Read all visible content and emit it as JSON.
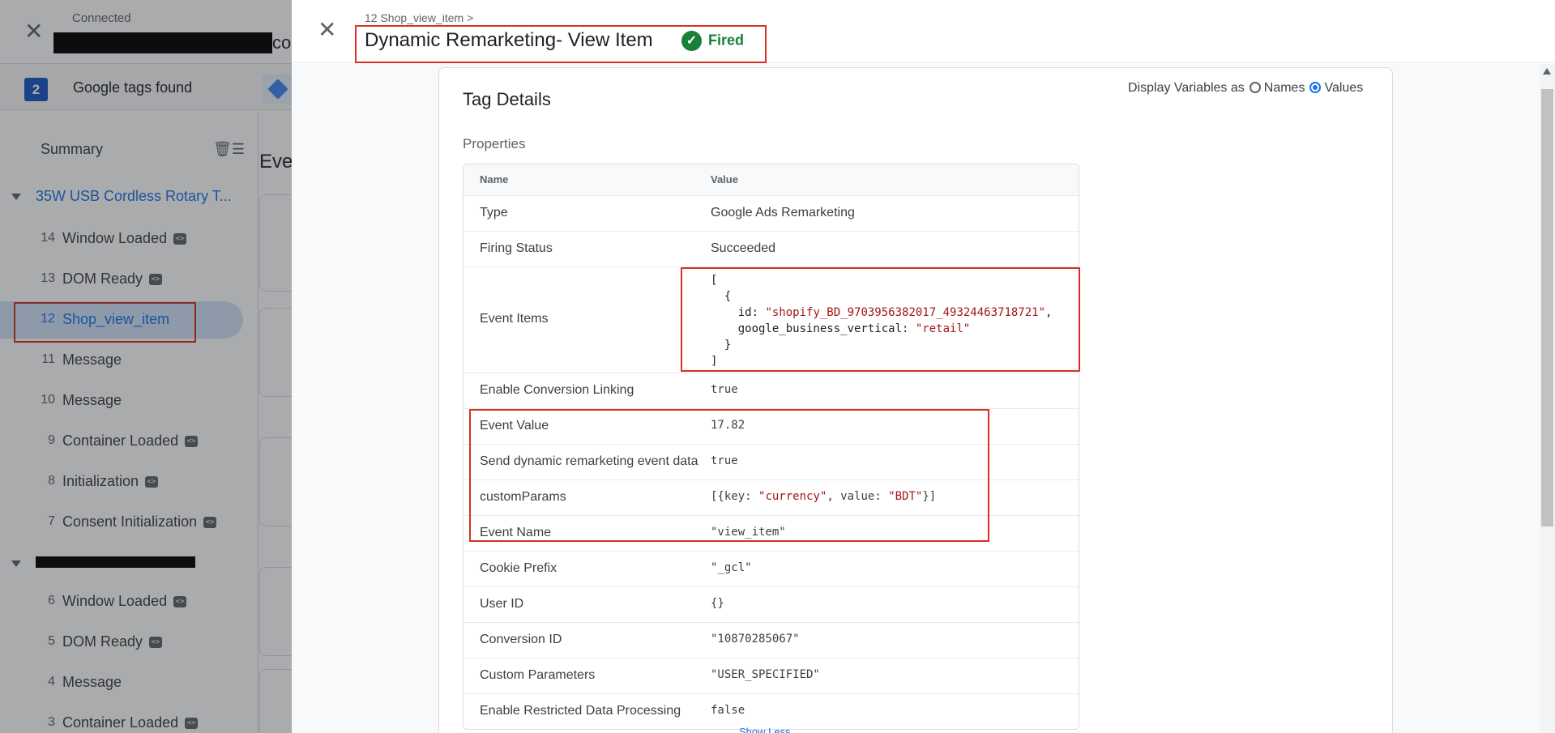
{
  "bg": {
    "connected": "Connected",
    "url_tail": "con",
    "tag_count": "2",
    "tags_found": "Google tags found",
    "main_heading": "Eve",
    "sidebar": {
      "summary": "Summary",
      "group1": "35W USB Cordless Rotary T...",
      "items": [
        {
          "num": "14",
          "label": "Window Loaded",
          "code": true
        },
        {
          "num": "13",
          "label": "DOM Ready",
          "code": true
        },
        {
          "num": "12",
          "label": "Shop_view_item",
          "code": false
        },
        {
          "num": "11",
          "label": "Message",
          "code": false
        },
        {
          "num": "10",
          "label": "Message",
          "code": false
        },
        {
          "num": "9",
          "label": "Container Loaded",
          "code": true
        },
        {
          "num": "8",
          "label": "Initialization",
          "code": true
        },
        {
          "num": "7",
          "label": "Consent Initialization",
          "code": true
        },
        {
          "num": "6",
          "label": "Window Loaded",
          "code": true
        },
        {
          "num": "5",
          "label": "DOM Ready",
          "code": true
        },
        {
          "num": "4",
          "label": "Message",
          "code": false
        },
        {
          "num": "3",
          "label": "Container Loaded",
          "code": true
        }
      ]
    }
  },
  "drawer": {
    "breadcrumb": "12 Shop_view_item >",
    "title": "Dynamic Remarketing- View Item",
    "status": "Fired",
    "card_title": "Tag Details",
    "display_vars_label": "Display Variables as",
    "names_label": "Names",
    "values_label": "Values",
    "properties_label": "Properties",
    "table": {
      "col_name": "Name",
      "col_value": "Value",
      "rows": [
        {
          "name": "Type",
          "value": "Google Ads Remarketing"
        },
        {
          "name": "Firing Status",
          "value": "Succeeded"
        },
        {
          "name": "Event Items",
          "value": "[\n  {\n    id: \"shopify_BD_9703956382017_49324463718721\",\n    google_business_vertical: \"retail\"\n  }\n]"
        },
        {
          "name": "Enable Conversion Linking",
          "value": "true"
        },
        {
          "name": "Event Value",
          "value": "17.82"
        },
        {
          "name": "Send dynamic remarketing event data",
          "value": "true"
        },
        {
          "name": "customParams",
          "value": "[{key: \"currency\", value: \"BDT\"}]"
        },
        {
          "name": "Event Name",
          "value": "\"view_item\""
        },
        {
          "name": "Cookie Prefix",
          "value": "\"_gcl\""
        },
        {
          "name": "User ID",
          "value": "{}"
        },
        {
          "name": "Conversion ID",
          "value": "\"10870285067\""
        },
        {
          "name": "Custom Parameters",
          "value": "\"USER_SPECIFIED\""
        },
        {
          "name": "Enable Restricted Data Processing",
          "value": "false"
        }
      ]
    },
    "show_less": "Show Less"
  }
}
